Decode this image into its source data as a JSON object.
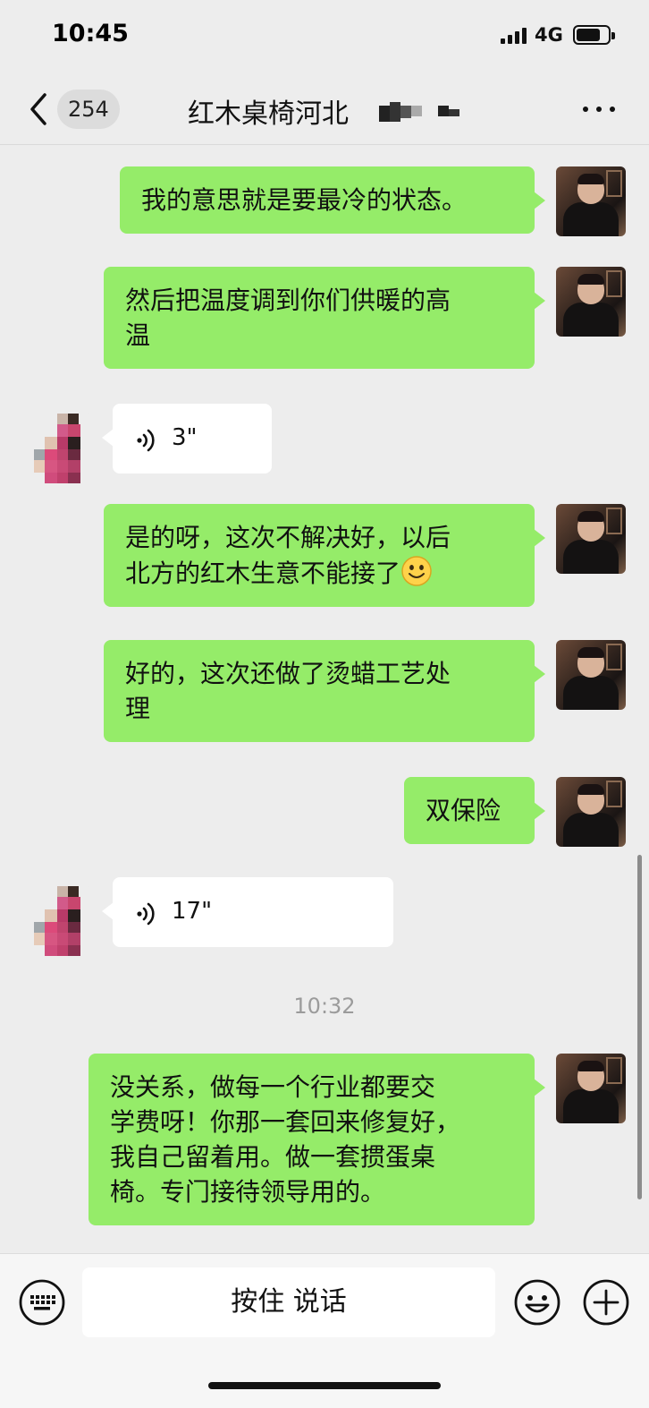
{
  "status_bar": {
    "time": "10:45",
    "network": "4G"
  },
  "nav": {
    "back_icon": "chevron-left-icon",
    "unread_count": "254",
    "title": "红木桌椅河北",
    "more_icon": "ellipsis-icon"
  },
  "messages": [
    {
      "side": "me",
      "type": "text",
      "lines": [
        "我的意思就是要最冷的状态。"
      ]
    },
    {
      "side": "me",
      "type": "text",
      "lines": [
        "然后把温度调到你们供暖的高",
        "温"
      ]
    },
    {
      "side": "other",
      "type": "voice",
      "duration": "3\""
    },
    {
      "side": "me",
      "type": "text",
      "lines": [
        "是的呀，这次不解决好，以后",
        "北方的红木生意不能接了"
      ],
      "emoji": "smile-emoji-icon"
    },
    {
      "side": "me",
      "type": "text",
      "lines": [
        "好的，这次还做了烫蜡工艺处",
        "理"
      ]
    },
    {
      "side": "me",
      "type": "text",
      "lines": [
        "双保险"
      ]
    },
    {
      "side": "other",
      "type": "voice",
      "duration": "17\""
    },
    {
      "side": "me",
      "type": "text",
      "lines": [
        "没关系，做每一个行业都要交",
        "学费呀！你那一套回来修复好，",
        "我自己留着用。做一套掼蛋桌",
        "椅。专门接待领导用的。"
      ]
    }
  ],
  "timestamp": "10:32",
  "input_bar": {
    "keyboard_icon": "keyboard-icon",
    "hold_to_talk": "按住 说话",
    "emoji_icon": "smile-icon",
    "plus_icon": "plus-circle-icon"
  },
  "colors": {
    "my_bubble": "#95ec69",
    "other_bubble": "#ffffff",
    "background": "#ededed"
  }
}
